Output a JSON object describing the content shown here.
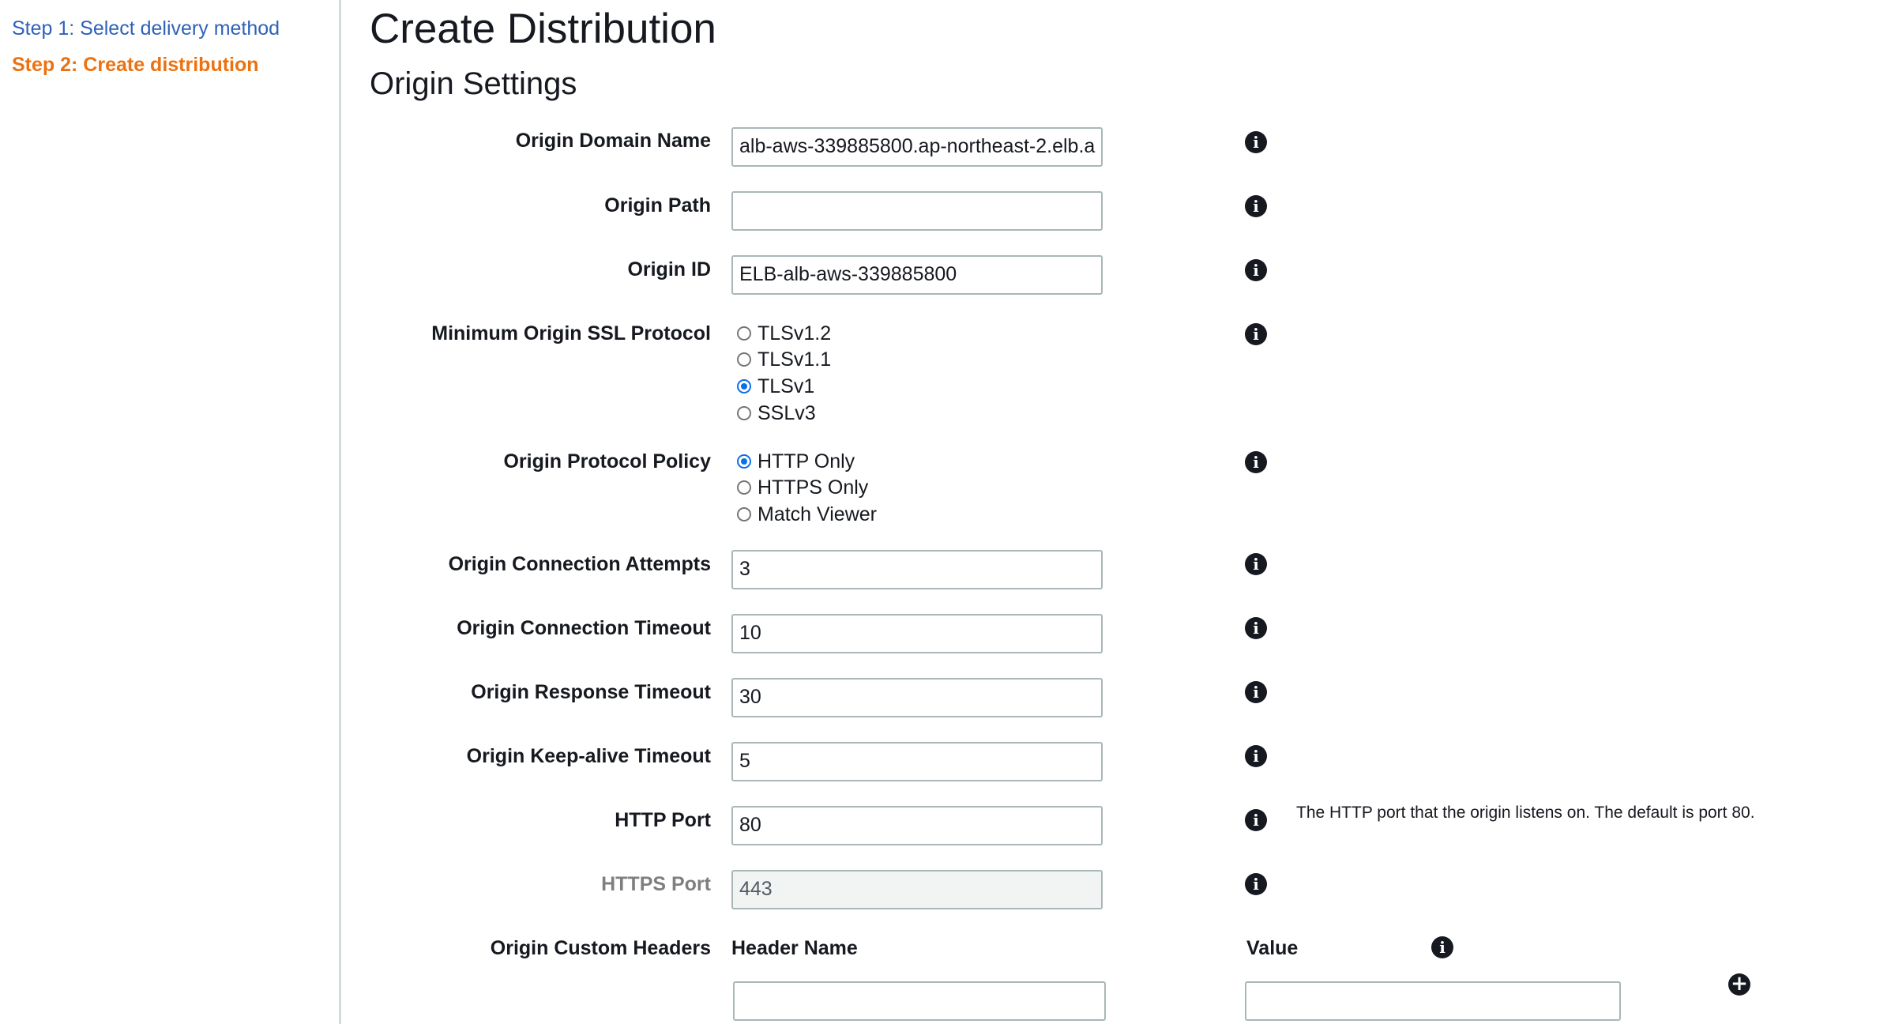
{
  "steps": {
    "step1": "Step 1: Select delivery method",
    "step2": "Step 2: Create distribution"
  },
  "page_title": "Create Distribution",
  "section_title": "Origin Settings",
  "fields": {
    "origin_domain_name": {
      "label": "Origin Domain Name",
      "value": "alb-aws-339885800.ap-northeast-2.elb.a"
    },
    "origin_path": {
      "label": "Origin Path",
      "value": ""
    },
    "origin_id": {
      "label": "Origin ID",
      "value": "ELB-alb-aws-339885800"
    },
    "min_ssl": {
      "label": "Minimum Origin SSL Protocol",
      "options": [
        "TLSv1.2",
        "TLSv1.1",
        "TLSv1",
        "SSLv3"
      ],
      "selected": "TLSv1"
    },
    "protocol_policy": {
      "label": "Origin Protocol Policy",
      "options": [
        "HTTP Only",
        "HTTPS Only",
        "Match Viewer"
      ],
      "selected": "HTTP Only"
    },
    "connection_attempts": {
      "label": "Origin Connection Attempts",
      "value": "3"
    },
    "connection_timeout": {
      "label": "Origin Connection Timeout",
      "value": "10"
    },
    "response_timeout": {
      "label": "Origin Response Timeout",
      "value": "30"
    },
    "keepalive_timeout": {
      "label": "Origin Keep-alive Timeout",
      "value": "5"
    },
    "http_port": {
      "label": "HTTP Port",
      "value": "80",
      "help": "The HTTP port that the origin listens on. The default is port 80."
    },
    "https_port": {
      "label": "HTTPS Port",
      "value": "443"
    },
    "custom_headers": {
      "label": "Origin Custom Headers",
      "header_name_col": "Header Name",
      "value_col": "Value",
      "header_name_value": "",
      "value_value": ""
    }
  },
  "icons": {
    "info": "info-icon",
    "add": "plus-circle-icon"
  },
  "colors": {
    "link": "#2f61b8",
    "active_step": "#ec7211",
    "radio_checked": "#0b6fe6"
  }
}
